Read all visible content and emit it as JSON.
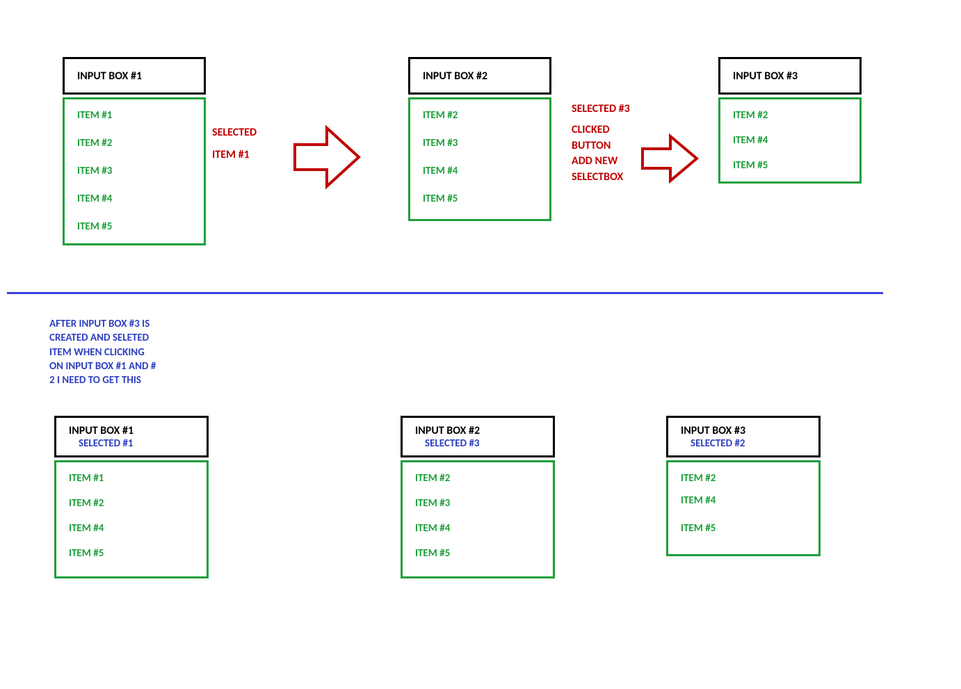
{
  "colors": {
    "green": "#1E9F3C",
    "red": "#C00000",
    "blue": "#2E3FBF",
    "divider": "#3B3FE0",
    "black": "#000000"
  },
  "top": {
    "box1": {
      "title": "INPUT BOX #1",
      "items": [
        "ITEM #1",
        "ITEM #2",
        "ITEM #3",
        "ITEM #4",
        "ITEM #5"
      ]
    },
    "caption1_line1": "SELECTED",
    "caption1_line2": "ITEM #1",
    "box2": {
      "title": "INPUT BOX #2",
      "items": [
        "ITEM #2",
        "ITEM #3",
        "ITEM #4",
        "ITEM #5"
      ]
    },
    "caption2_line1": "SELECTED #3",
    "caption2_line2": "CLICKED",
    "caption2_line3": "BUTTON",
    "caption2_line4": "ADD NEW",
    "caption2_line5": "SELECTBOX",
    "box3": {
      "title": "INPUT BOX #3",
      "items": [
        "ITEM #2",
        "ITEM #4",
        "ITEM #5"
      ]
    }
  },
  "note": {
    "l1": "AFTER INPUT BOX #3 IS",
    "l2": "CREATED AND SELETED",
    "l3": "ITEM WHEN CLICKING",
    "l4": "ON INPUT BOX #1 AND #",
    "l5": "2 I NEED TO GET THIS"
  },
  "bottom": {
    "box1": {
      "title": "INPUT BOX #1",
      "subtitle": "SELECTED #1",
      "items": [
        "ITEM #1",
        "ITEM #2",
        "ITEM #4",
        "ITEM #5"
      ]
    },
    "box2": {
      "title": "INPUT BOX #2",
      "subtitle": "SELECTED #3",
      "items": [
        "ITEM #2",
        "ITEM #3",
        "ITEM #4",
        "ITEM #5"
      ]
    },
    "box3": {
      "title": "INPUT BOX #3",
      "subtitle": "SELECTED #2",
      "items": [
        "ITEM #2",
        "ITEM #4",
        "ITEM #5"
      ]
    }
  }
}
